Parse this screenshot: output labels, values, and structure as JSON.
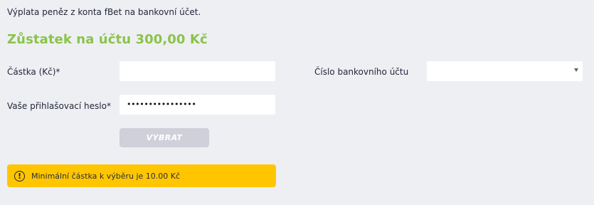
{
  "intro": "Výplata peněz z konta fBet na bankovní účet.",
  "balance": "Zůstatek na účtu 300,00 Kč",
  "form": {
    "amount_label": "Částka (Kč)*",
    "amount_value": "",
    "password_label": "Vaše přihlašovací heslo*",
    "password_mask": "••••••••••••••••",
    "bank_account_label": "Číslo bankovního účtu",
    "bank_account_selected": "",
    "submit_label": "VYBRAT"
  },
  "alert": {
    "icon": "exclamation-circle-icon",
    "text": "Minimální částka k výběru je 10.00 Kč"
  },
  "colors": {
    "accent_green": "#8bc34a",
    "warning_yellow": "#ffc600",
    "button_disabled": "#cfd0da",
    "background": "#eeeff3"
  }
}
